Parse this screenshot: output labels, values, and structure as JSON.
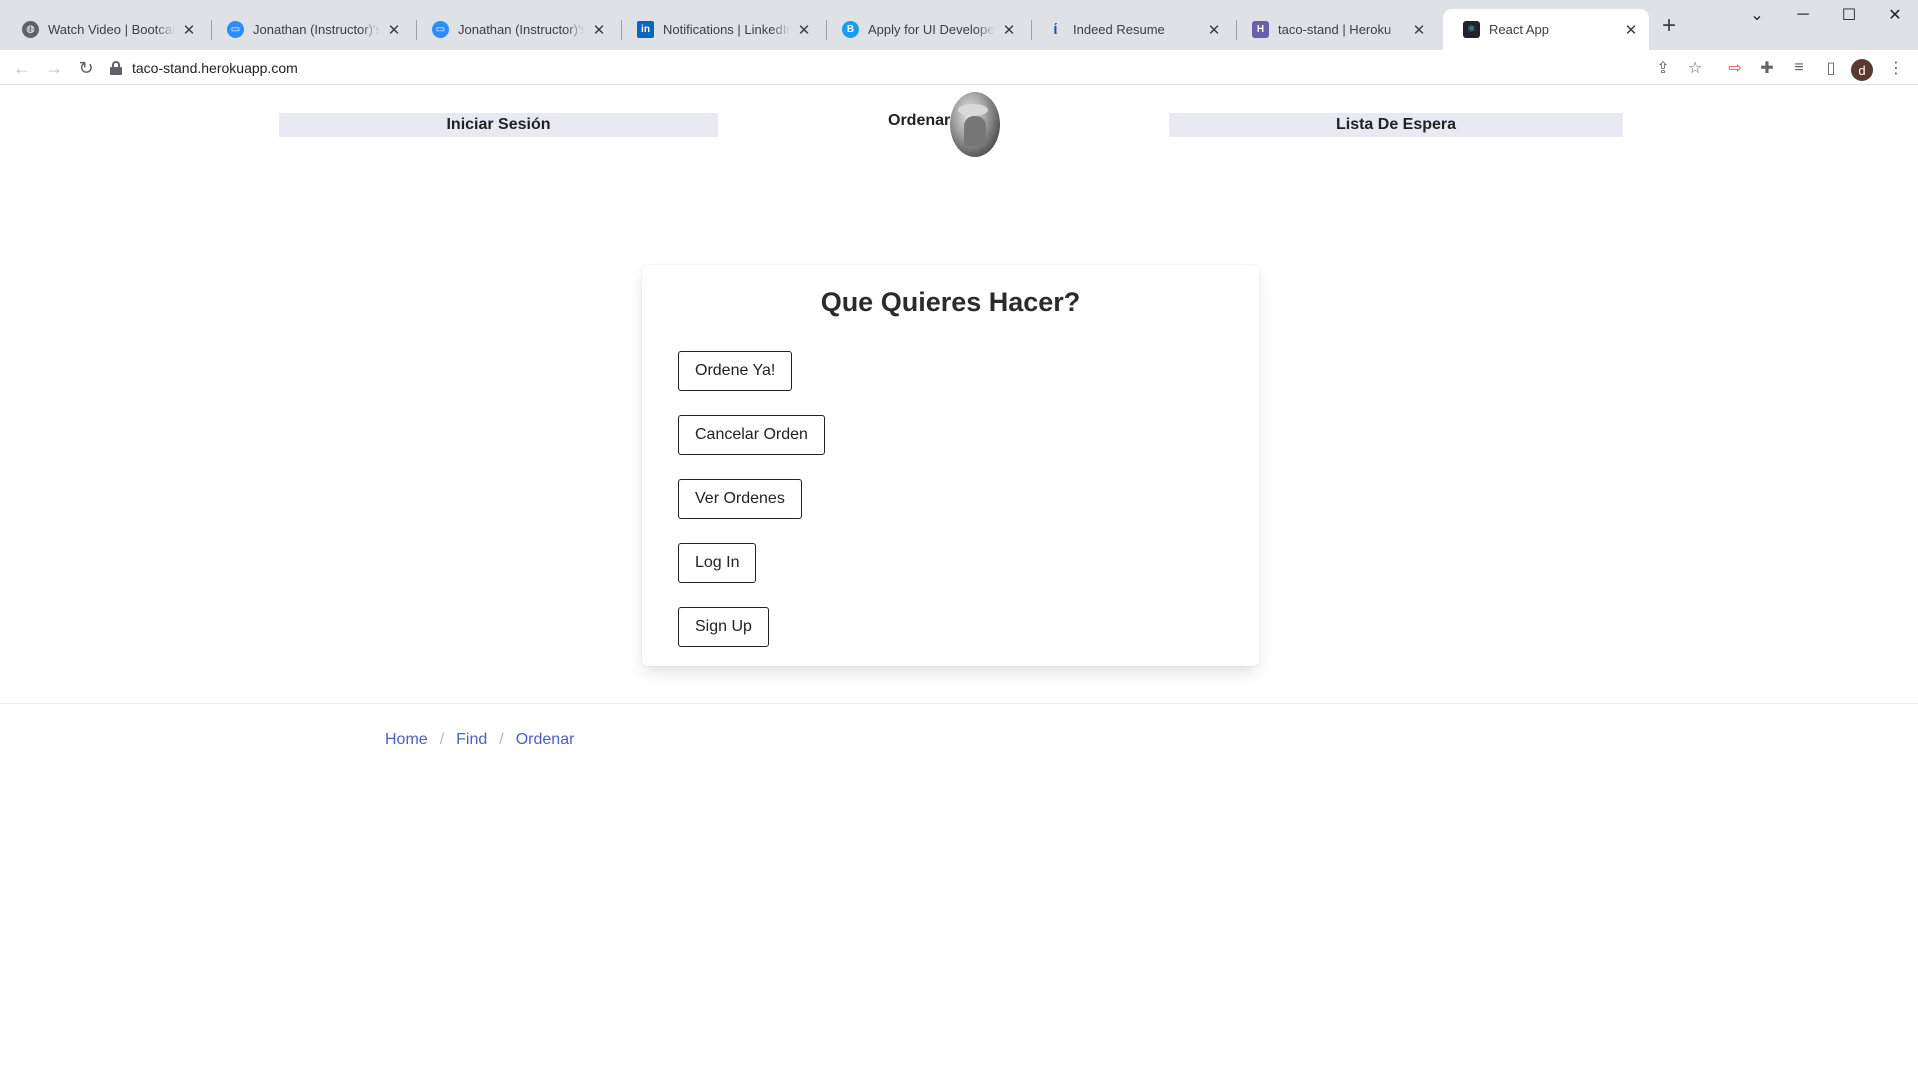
{
  "browser": {
    "tabs": [
      {
        "title": "Watch Video | Bootcamp S",
        "icon": "globe-icon",
        "icon_color": "#5f6368"
      },
      {
        "title": "Jonathan (Instructor)'s Per",
        "icon": "zoom-icon",
        "icon_color": "#2d8cff"
      },
      {
        "title": "Jonathan (Instructor)'s Per",
        "icon": "zoom-icon",
        "icon_color": "#2d8cff"
      },
      {
        "title": "Notifications | LinkedIn",
        "icon": "linkedin-icon",
        "icon_color": "#0a66c2"
      },
      {
        "title": "Apply for UI Developer (Er",
        "icon": "bullhorn-icon",
        "icon_color": "#1a9cf0"
      },
      {
        "title": "Indeed Resume",
        "icon": "indeed-icon",
        "icon_color": "#2557a7"
      },
      {
        "title": "taco-stand | Heroku",
        "icon": "heroku-icon",
        "icon_color": "#6762a6"
      },
      {
        "title": "React App",
        "icon": "react-icon",
        "icon_color": "#20232a",
        "active": true
      }
    ],
    "url": "taco-stand.herokuapp.com",
    "profile_initial": "d"
  },
  "nav": {
    "login_label": "Iniciar Sesión",
    "brand_label": "Ordenar",
    "waitlist_label": "Lista De Espera"
  },
  "card": {
    "title": "Que Quieres Hacer?",
    "actions": [
      "Ordene Ya!",
      "Cancelar Orden",
      "Ver Ordenes",
      "Log In",
      "Sign Up"
    ]
  },
  "breadcrumb": {
    "items": [
      "Home",
      "Find",
      "Ordenar"
    ]
  },
  "colors": {
    "nav_bg": "#e8e9f3",
    "link": "#485fc7"
  }
}
